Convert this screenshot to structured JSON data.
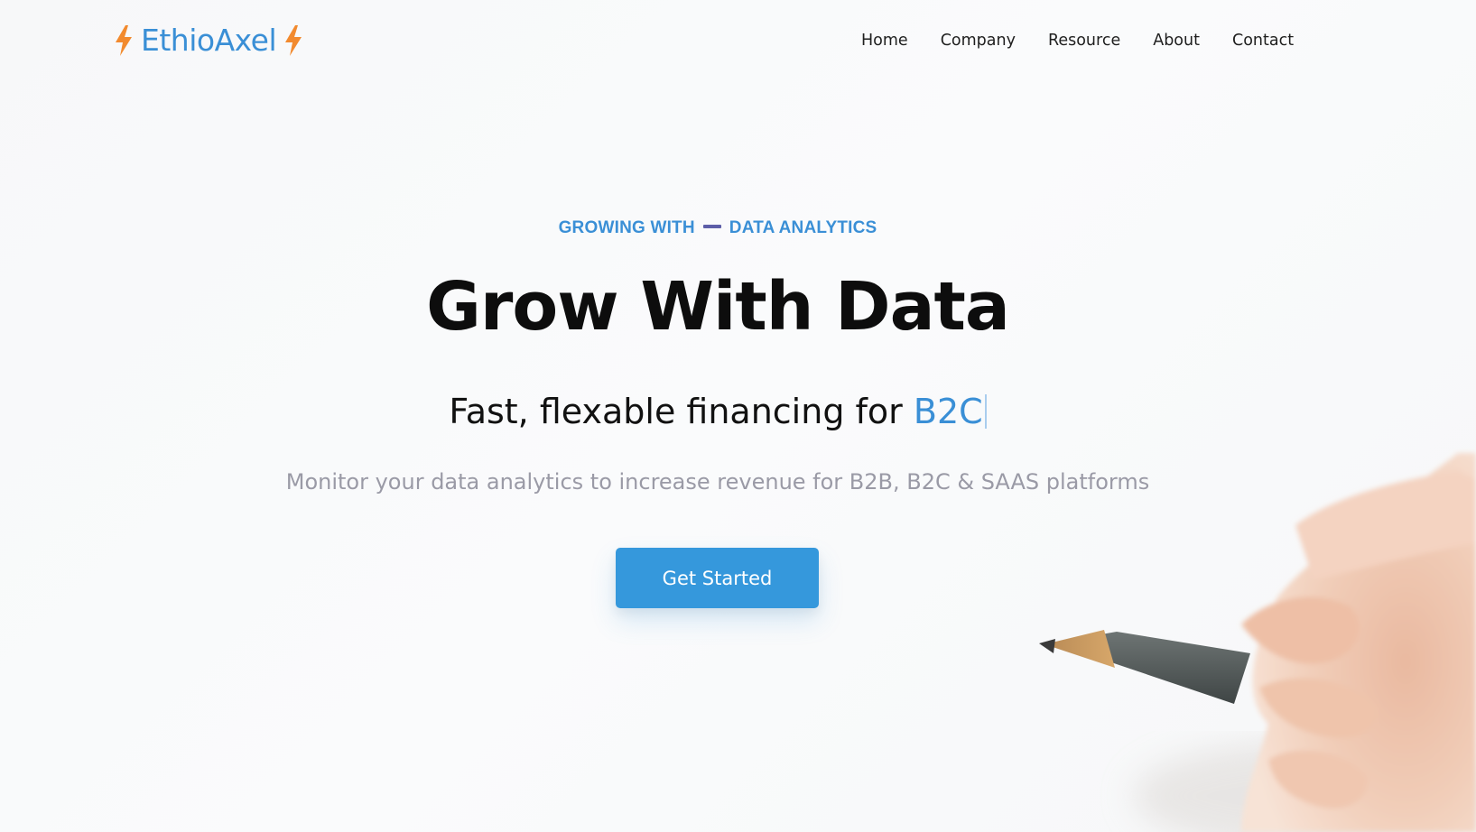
{
  "brand": {
    "name": "EthioAxel",
    "accent_color": "#3a8fd6",
    "bolt_color": "#f28a2e",
    "icons": [
      "lightning-bolt-icon",
      "lightning-bolt-icon"
    ]
  },
  "nav": {
    "items": [
      {
        "label": "Home"
      },
      {
        "label": "Company"
      },
      {
        "label": "Resource"
      },
      {
        "label": "About"
      },
      {
        "label": "Contact"
      }
    ]
  },
  "hero": {
    "eyebrow_left": "GROWING WITH",
    "eyebrow_right": "DATA ANALYTICS",
    "headline": "Grow With Data",
    "subhead_prefix": "Fast, flexable financing for",
    "subhead_highlight": "B2C",
    "description": "Monitor your data analytics to increase revenue for B2B, B2C & SAAS platforms",
    "cta_label": "Get Started",
    "cta_color": "#3598dc"
  },
  "background": {
    "image": "hand-holding-pencil"
  }
}
